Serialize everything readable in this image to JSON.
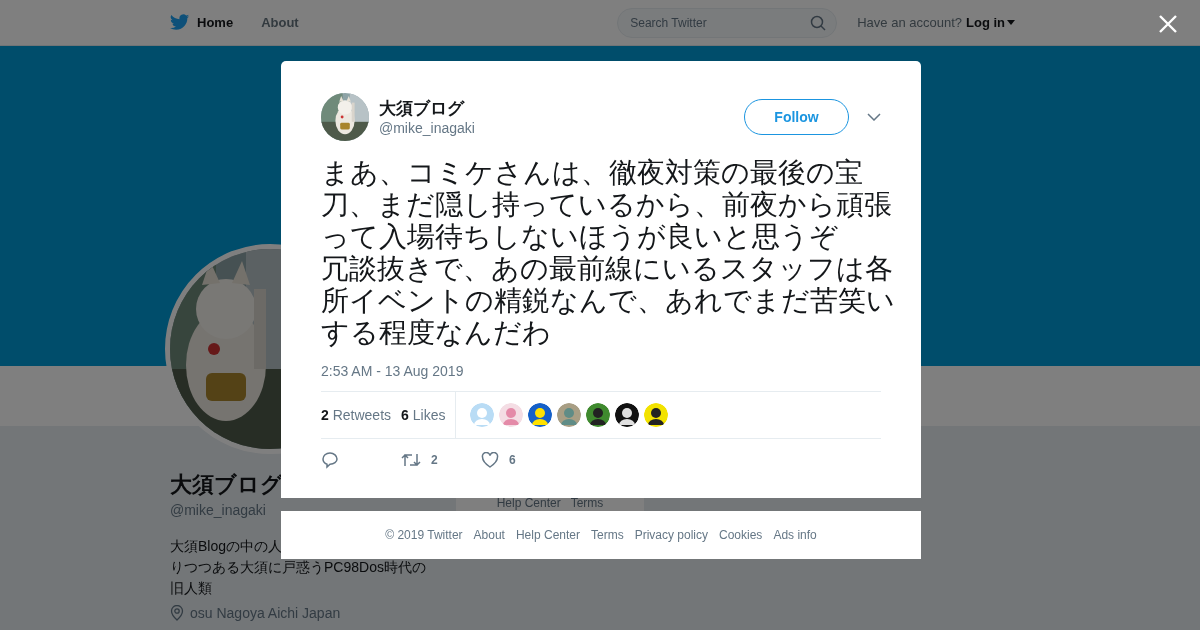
{
  "top_nav": {
    "links": [
      {
        "label": "Home",
        "selected": true
      },
      {
        "label": "About",
        "selected": false
      }
    ],
    "search": {
      "placeholder": "Search Twitter"
    },
    "account_prompt": "Have an account?",
    "login": "Log in"
  },
  "profile": {
    "name": "大須ブログ",
    "handle": "@mike_inagaki",
    "bio_lines": [
      "大須Blogの中の人",
      "りつつある大須に戸惑うPC98Dos時代の",
      "旧人類"
    ],
    "location": "osu Nagoya Aichi Japan",
    "side_links": [
      "Help Center",
      "Terms"
    ]
  },
  "tweet": {
    "author": {
      "name": "大須ブログ",
      "handle": "@mike_inagaki"
    },
    "follow_button": "Follow",
    "paragraphs": [
      "まあ、コミケさんは、徹夜対策の最後の宝刀、まだ隠し持っているから、前夜から頑張って入場待ちしないほうが良いと思うぞ",
      "冗談抜きで、あの最前線にいるスタッフは各所イベントの精鋭なんで、あれでまだ苦笑いする程度なんだわ"
    ],
    "timestamp": "2:53 AM - 13 Aug 2019",
    "stats": [
      "**2** Retweets",
      "**6** Likes"
    ],
    "likers": [
      {
        "kind": "picture"
      },
      {
        "kind": "picture"
      },
      {
        "kind": "picture"
      },
      {
        "kind": "picture"
      },
      {
        "kind": "picture"
      },
      {
        "kind": "picture"
      },
      {
        "kind": "picture"
      }
    ],
    "actions": [
      {
        "kind": "reply"
      },
      {
        "kind": "retweet",
        "count": "2"
      },
      {
        "kind": "like",
        "count": "6"
      }
    ]
  },
  "footer": [
    "© 2019 Twitter",
    "About",
    "Help Center",
    "Terms",
    "Privacy policy",
    "Cookies",
    "Ads info"
  ]
}
